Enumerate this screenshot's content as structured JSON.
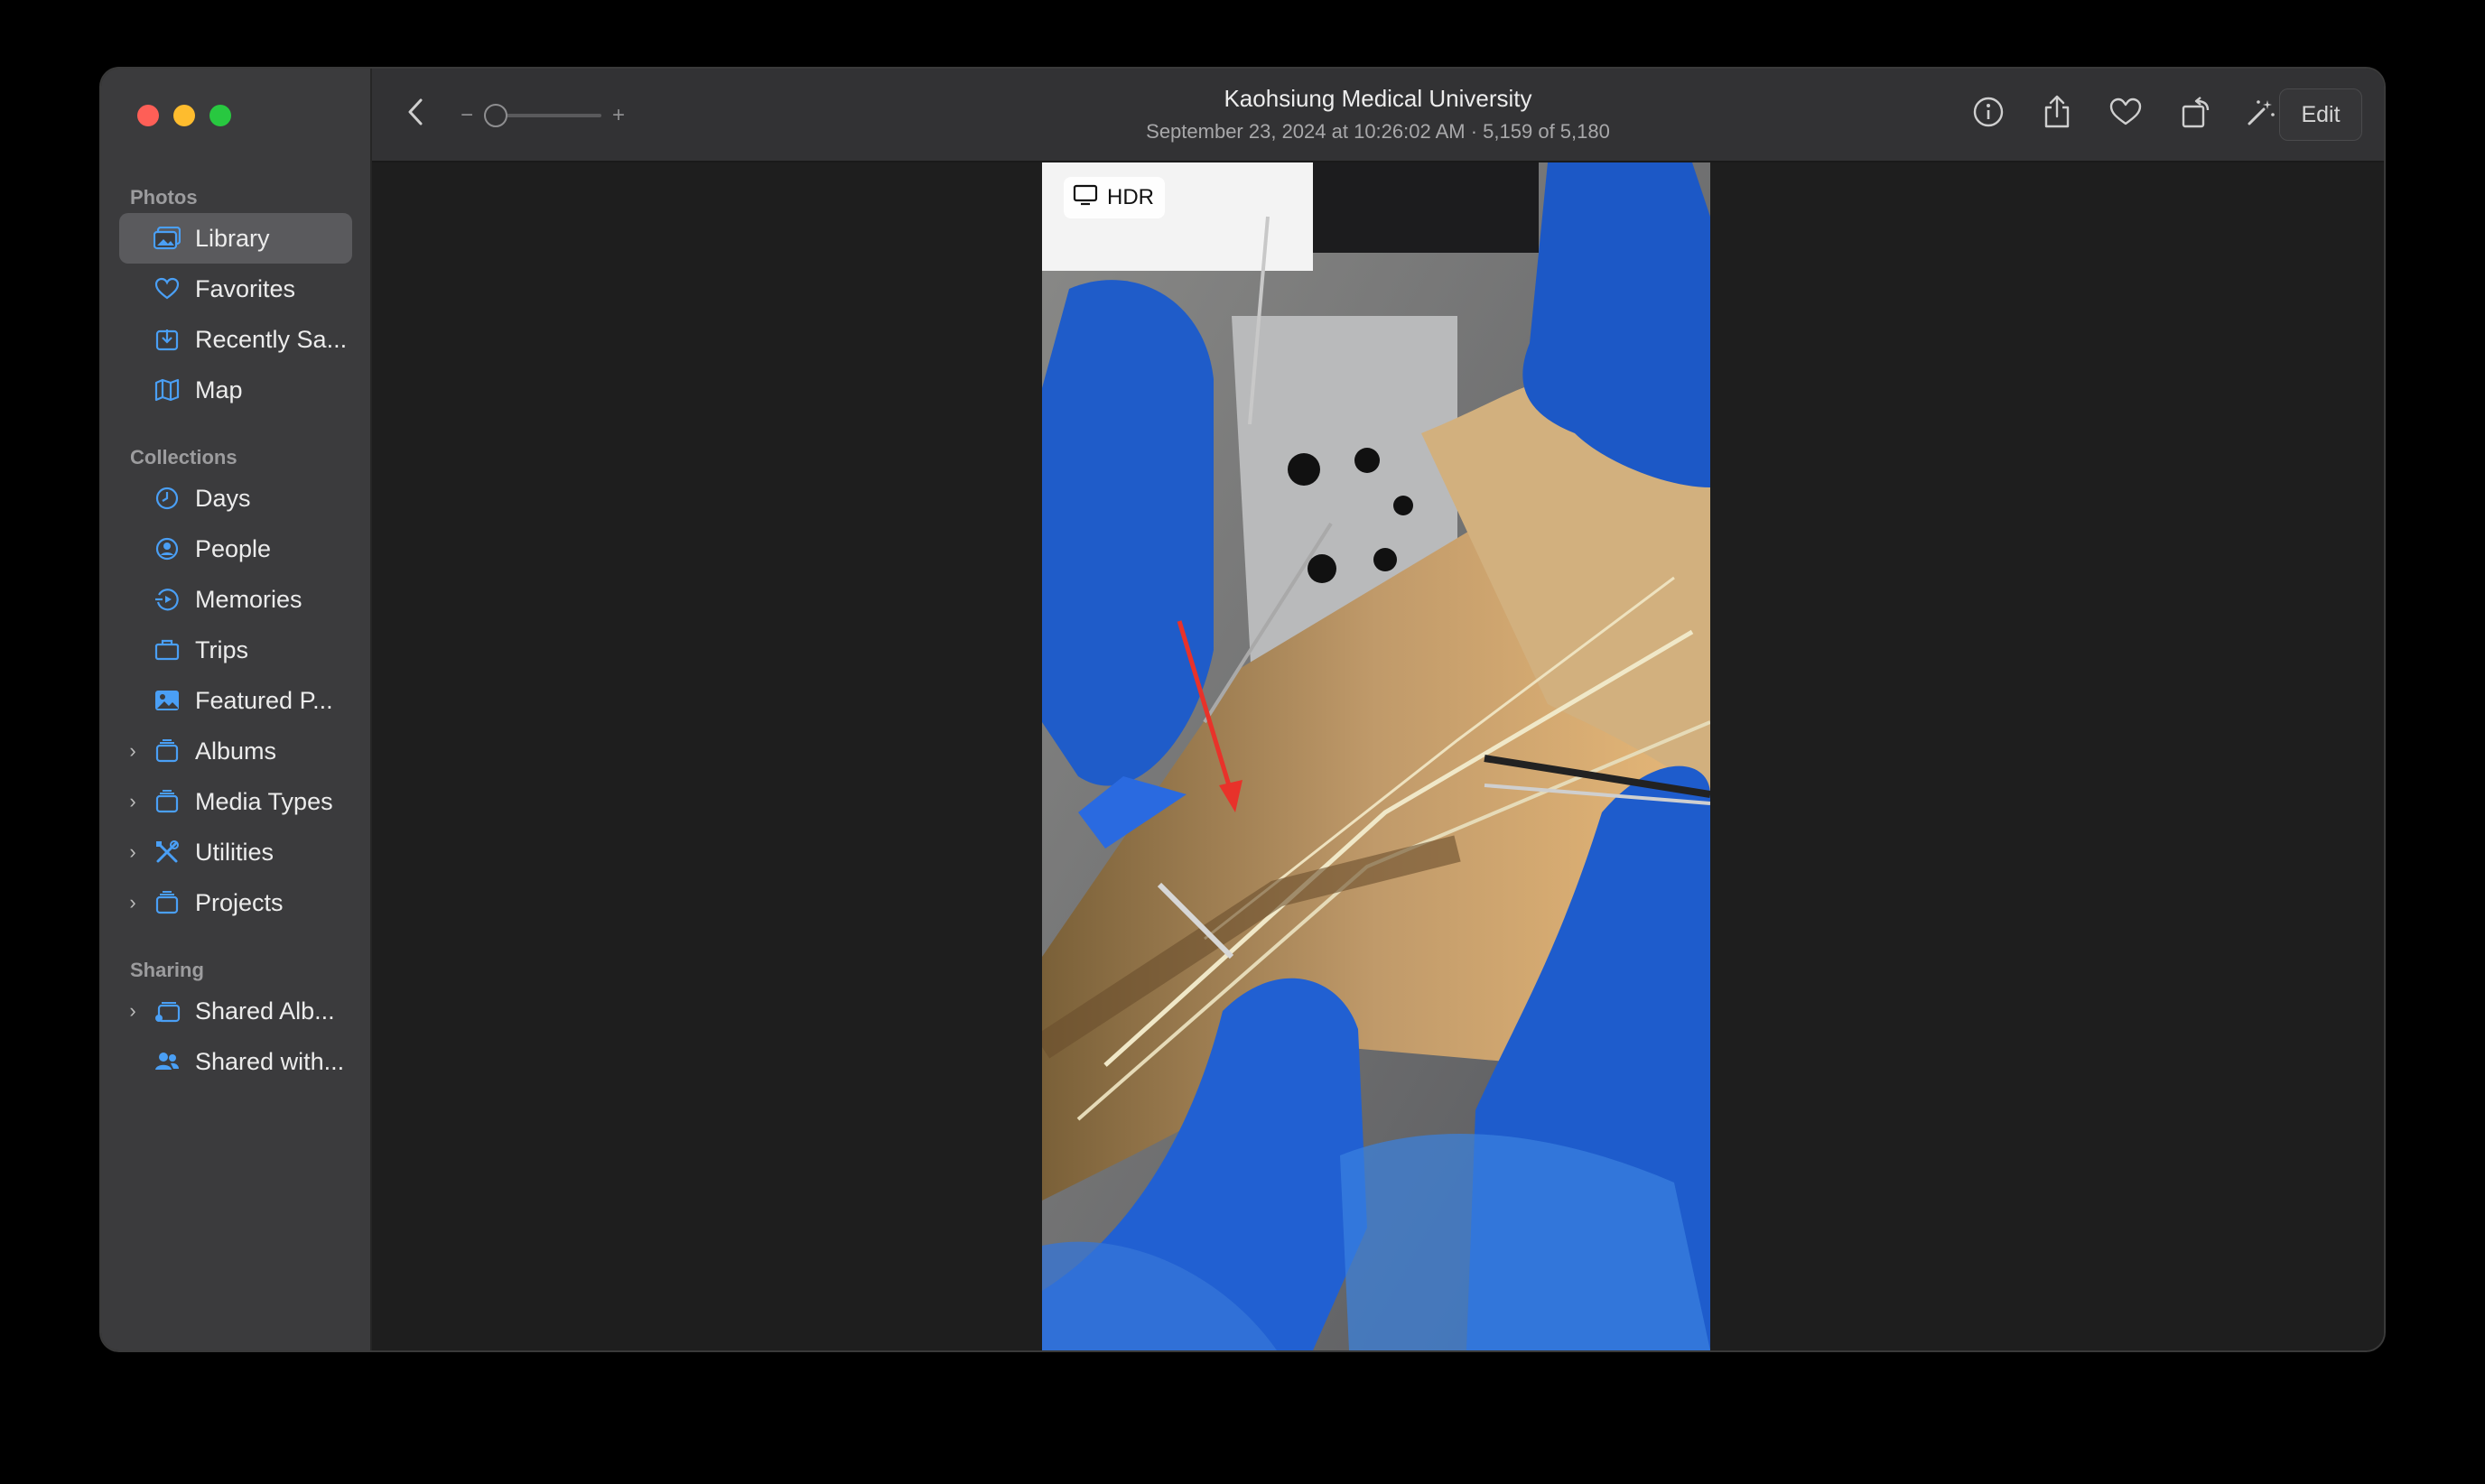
{
  "window": {
    "title": "Kaohsiung Medical University",
    "subtitle": "September 23, 2024 at 10:26:02 AM  ·  5,159 of 5,180"
  },
  "sidebar": {
    "sections": [
      {
        "title": "Photos",
        "items": [
          {
            "label": "Library",
            "icon": "photo-library-icon",
            "selected": true
          },
          {
            "label": "Favorites",
            "icon": "heart-icon"
          },
          {
            "label": "Recently Sa...",
            "icon": "download-tray-icon"
          },
          {
            "label": "Map",
            "icon": "map-icon"
          }
        ]
      },
      {
        "title": "Collections",
        "items": [
          {
            "label": "Days",
            "icon": "clock-icon"
          },
          {
            "label": "People",
            "icon": "person-circle-icon"
          },
          {
            "label": "Memories",
            "icon": "memories-icon"
          },
          {
            "label": "Trips",
            "icon": "suitcase-icon"
          },
          {
            "label": "Featured P...",
            "icon": "photo-icon"
          },
          {
            "label": "Albums",
            "icon": "folder-stack-icon",
            "expandable": true
          },
          {
            "label": "Media Types",
            "icon": "folder-stack-icon",
            "expandable": true
          },
          {
            "label": "Utilities",
            "icon": "tools-icon",
            "expandable": true
          },
          {
            "label": "Projects",
            "icon": "folder-stack-icon",
            "expandable": true
          }
        ]
      },
      {
        "title": "Sharing",
        "items": [
          {
            "label": "Shared Alb...",
            "icon": "shared-album-icon",
            "expandable": true
          },
          {
            "label": "Shared with...",
            "icon": "people-icon"
          }
        ]
      }
    ]
  },
  "toolbar": {
    "zoom_minus": "−",
    "zoom_plus": "+",
    "zoom_level": 0,
    "edit_label": "Edit",
    "icons": [
      "back-chevron-icon",
      "info-icon",
      "share-icon",
      "heart-icon",
      "rotate-icon",
      "magic-wand-icon"
    ]
  },
  "photo": {
    "badge": "HDR"
  },
  "colors": {
    "accent": "#4a9ff5",
    "selected_row": "#5a5a5d",
    "sidebar_bg": "#3b3b3d"
  }
}
